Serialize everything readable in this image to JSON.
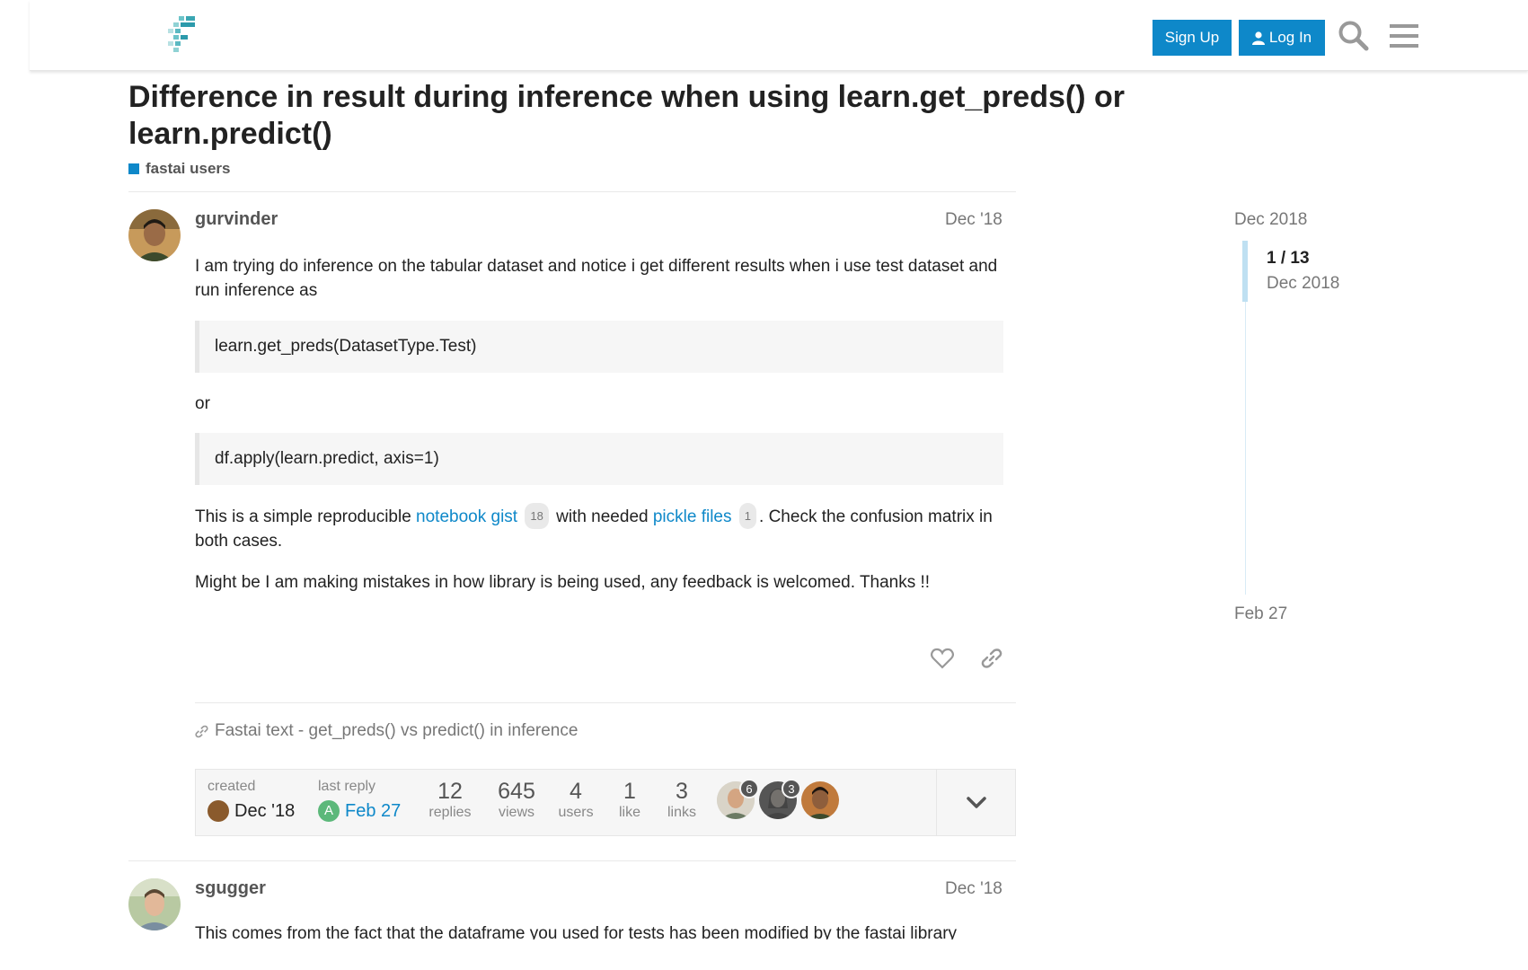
{
  "header": {
    "signup_label": "Sign Up",
    "login_label": "Log In",
    "brand_color": "#0e88c9"
  },
  "topic": {
    "title": "Difference in result during inference when using learn.get_preds() or learn.predict()",
    "category": "fastai users"
  },
  "post1": {
    "username": "gurvinder",
    "date": "Dec '18",
    "para1": "I am trying do inference on the tabular dataset and notice i get different results when i use test dataset and run inference as",
    "code1": "learn.get_preds(DatasetType.Test)",
    "or_text": "or",
    "code2": "df.apply(learn.predict, axis=1)",
    "para3_a": "This is a simple reproducible ",
    "link1_text": "notebook gist",
    "link1_clicks": "18",
    "para3_b": " with needed ",
    "link2_text": "pickle files",
    "link2_clicks": "1",
    "para3_c": ". Check the confusion matrix in both cases.",
    "para4": "Might be I am making mistakes in how library is being used, any feedback is welcomed. Thanks !!",
    "linked_topic": "Fastai text - get_preds() vs predict() in inference"
  },
  "topic_map": {
    "created_label": "created",
    "created_date": "Dec '18",
    "last_reply_label": "last reply",
    "last_reply_avatar_letter": "A",
    "last_reply_date": "Feb 27",
    "replies": "12",
    "replies_label": "replies",
    "views": "645",
    "views_label": "views",
    "users": "4",
    "users_label": "users",
    "likes": "1",
    "likes_label": "like",
    "links": "3",
    "links_label": "links",
    "participants": [
      {
        "count": "6"
      },
      {
        "count": "3"
      },
      {
        "count": ""
      }
    ]
  },
  "post2": {
    "username": "sgugger",
    "date": "Dec '18",
    "para1": "This comes from the fact that the dataframe you used for tests has been modified by the fastai library"
  },
  "timeline": {
    "start_date": "Dec 2018",
    "position": "1 / 13",
    "position_date": "Dec 2018",
    "end_date": "Feb 27"
  }
}
